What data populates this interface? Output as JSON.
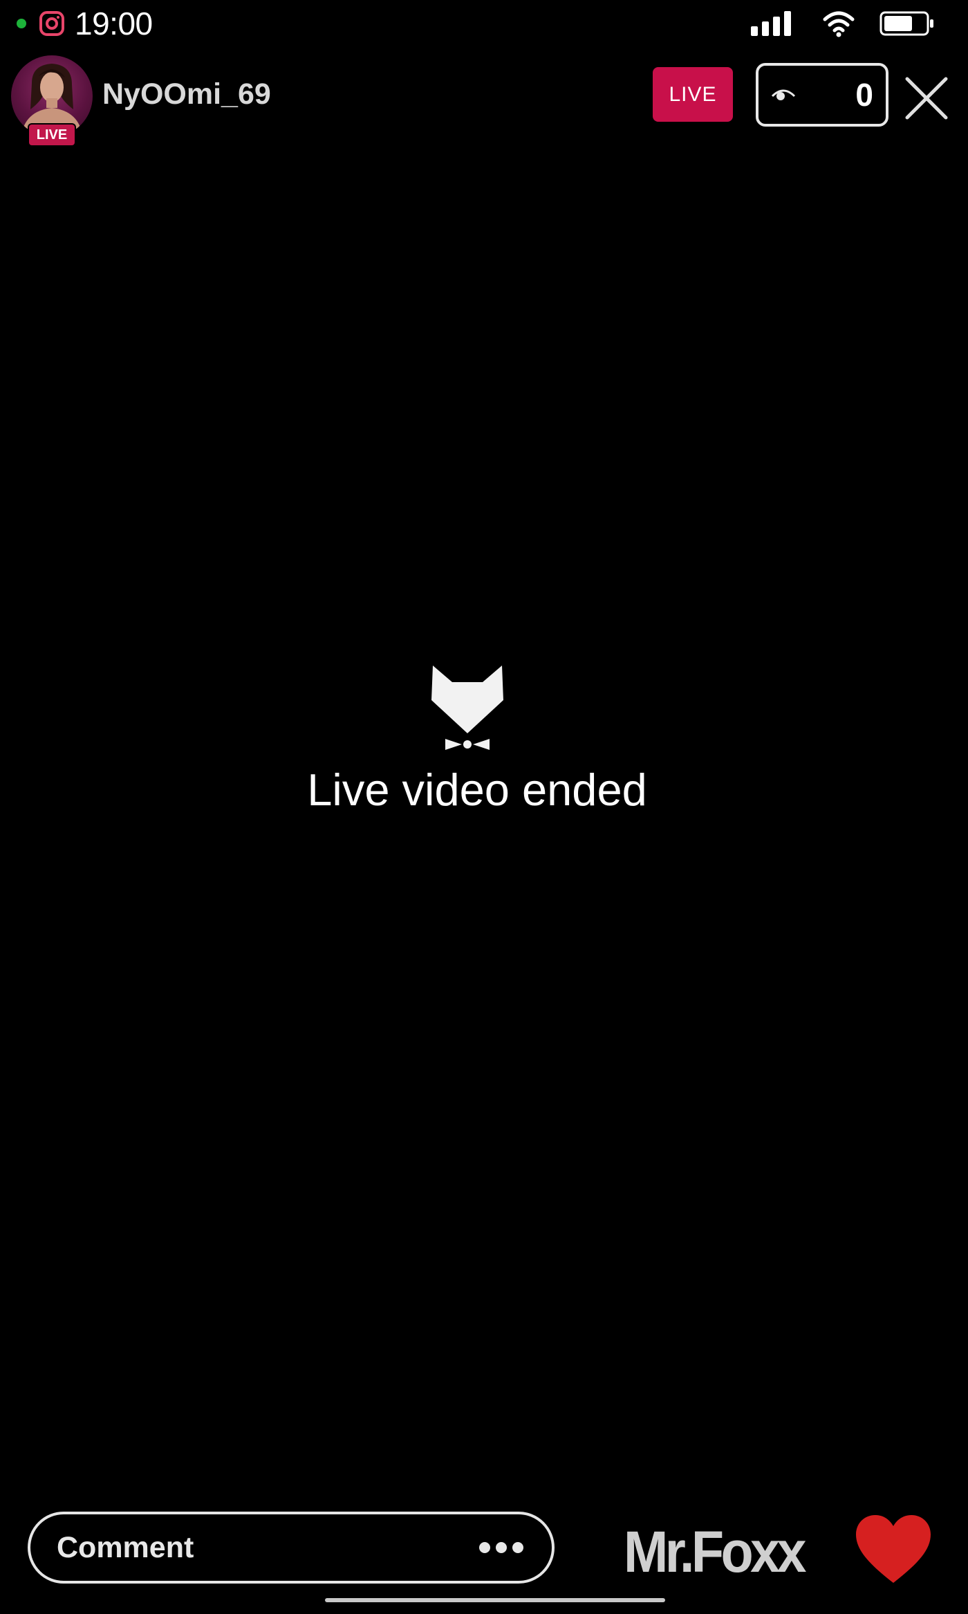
{
  "status_bar": {
    "time": "19:00",
    "icons": [
      "green-dot",
      "instagram-icon",
      "signal-icon",
      "wifi-icon",
      "battery-icon"
    ]
  },
  "header": {
    "username": "NyOOmi_69",
    "avatar_badge": "LIVE",
    "live_label": "LIVE",
    "viewer_count": "0",
    "icons": [
      "eye-icon",
      "close-icon"
    ]
  },
  "main": {
    "icon": "fox-icon",
    "message": "Live video ended"
  },
  "footer": {
    "comment_placeholder": "Comment",
    "brand": "Mr.Foxx",
    "icons": [
      "more-dots-icon",
      "heart-icon"
    ]
  },
  "colors": {
    "background": "#000000",
    "live_red": "#c8104a",
    "heart_red": "#d62020",
    "status_green": "#1db33a"
  }
}
